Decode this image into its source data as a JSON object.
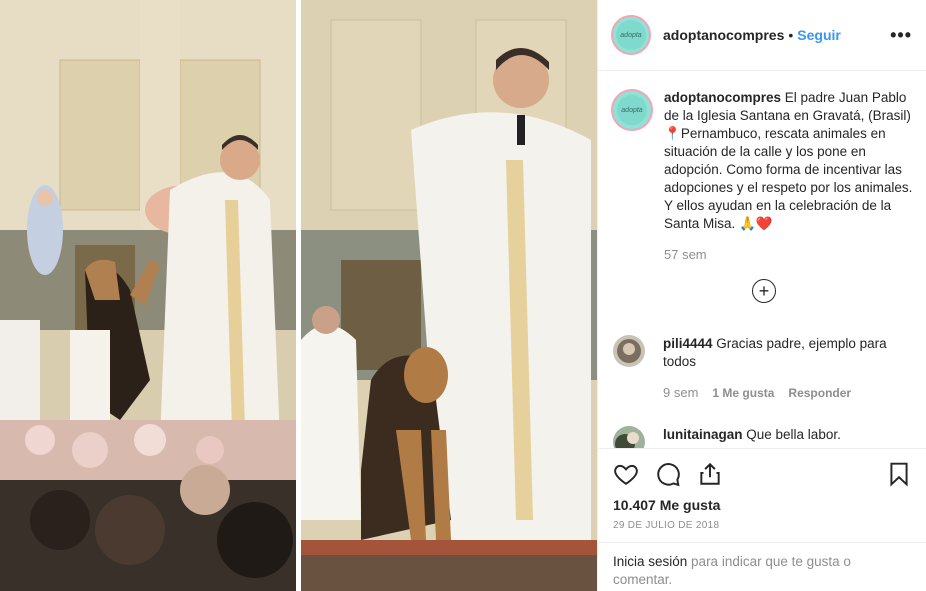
{
  "post": {
    "author": "adoptanocompres",
    "separator": "•",
    "follow_label": "Seguir",
    "more_icon": "more-options-icon",
    "more_glyph": "•••"
  },
  "avatar_badge": "adopta",
  "caption": {
    "author": "adoptanocompres",
    "text_1": " El padre Juan Pablo de la Iglesia Santana en Gravatá, (Brasil) ",
    "pin_emoji": "📍",
    "text_2": "Pernambuco, rescata animales en situación de la calle y los pone en adopción. Como forma de incentivar las adopciones y el respeto por los animales. Y ellos ayudan en la celebración de la Santa Misa. ",
    "emojis": "🙏❤️",
    "time": "57 sem"
  },
  "load_more_glyph": "+",
  "comments": [
    {
      "author": "pili4444",
      "text": " Gracias padre, ejemplo para todos",
      "time": "9 sem",
      "likes": "1 Me gusta",
      "reply": "Responder"
    },
    {
      "author": "lunitainagan",
      "text": " Que bella labor."
    }
  ],
  "actions": {
    "like_icon": "heart-icon",
    "comment_icon": "comment-icon",
    "share_icon": "share-icon",
    "save_icon": "bookmark-icon"
  },
  "likes": "10.407 Me gusta",
  "date": "29 DE JULIO DE 2018",
  "login": {
    "link": "Inicia sesión",
    "text": " para indicar que te gusta o comentar."
  },
  "colors": {
    "accent": "#3897f0",
    "secondary_text": "#8e8e8e",
    "border": "#efefef",
    "avatar_bg": "#8fe2d6"
  }
}
